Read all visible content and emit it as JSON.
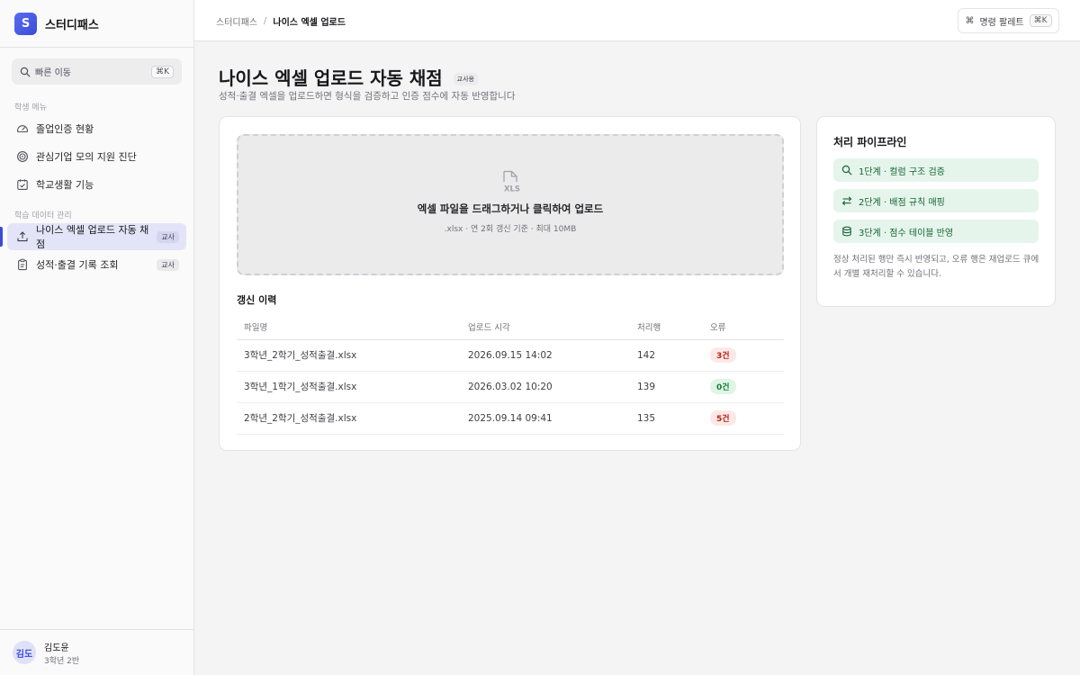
{
  "brand": {
    "logo_letter": "S",
    "name": "스터디패스"
  },
  "sidebar": {
    "search": {
      "label": "빠른 이동",
      "shortcut": "⌘K"
    },
    "groups": [
      {
        "label": "학생 메뉴",
        "items": [
          {
            "label": "졸업인증 현황",
            "icon": "dashboard-gauge-icon"
          },
          {
            "label": "관심기업 모의 지원 진단",
            "icon": "target-icon"
          },
          {
            "label": "학교생활 기능",
            "icon": "calendar-check-icon"
          }
        ]
      },
      {
        "label": "학습 데이터 관리",
        "items": [
          {
            "label": "나이스 엑셀 업로드 자동 채점",
            "icon": "upload-icon",
            "tag": "교사",
            "active": true
          },
          {
            "label": "성적·출결 기록 조회",
            "icon": "clipboard-icon",
            "tag": "교사"
          }
        ]
      }
    ],
    "user": {
      "initials": "김도",
      "name": "김도윤",
      "sub": "3학년 2반"
    }
  },
  "topbar": {
    "breadcrumb": [
      "스터디패스",
      "나이스 엑셀 업로드"
    ],
    "breadcrumb_sep": "/",
    "command": {
      "symbol": "⌘",
      "label": "명령 팔레트",
      "shortcut": "⌘K"
    }
  },
  "page": {
    "title": "나이스 엑셀 업로드 자동 채점",
    "badge": "교사용",
    "subtitle": "성적·출결 엑셀을 업로드하면 형식을 검증하고 인증 점수에 자동 반영합니다"
  },
  "dropzone": {
    "icon": "xls-file-icon",
    "icon_text": "XLS",
    "title": "엑셀 파일을 드래그하거나 클릭하여 업로드",
    "hint": ".xlsx · 연 2회 갱신 기준 · 최대 10MB"
  },
  "history": {
    "title": "갱신 이력",
    "columns": [
      "파일명",
      "업로드 시각",
      "처리행",
      "오류"
    ],
    "rows": [
      {
        "file": "3학년_2학기_성적출결.xlsx",
        "time": "2026.09.15 14:02",
        "rows": "142",
        "errors": "3건",
        "status": "error"
      },
      {
        "file": "3학년_1학기_성적출결.xlsx",
        "time": "2026.03.02 10:20",
        "rows": "139",
        "errors": "0건",
        "status": "ok"
      },
      {
        "file": "2학년_2학기_성적출결.xlsx",
        "time": "2025.09.14 09:41",
        "rows": "135",
        "errors": "5건",
        "status": "error"
      }
    ]
  },
  "pipeline": {
    "title": "처리 파이프라인",
    "steps": [
      {
        "label": "1단계 · 컬럼 구조 검증",
        "icon": "search-icon"
      },
      {
        "label": "2단계 · 배점 규칙 매핑",
        "icon": "swap-arrows-icon"
      },
      {
        "label": "3단계 · 점수 테이블 반영",
        "icon": "database-icon"
      }
    ],
    "note": "정상 처리된 행만 즉시 반영되고, 오류 행은 재업로드 큐에서 개별 재처리할 수 있습니다."
  },
  "colors": {
    "accent": "#3b4bd8",
    "step_bg": "#e6f5ec",
    "step_text": "#166534",
    "error": "#b42318",
    "ok": "#15803d"
  }
}
